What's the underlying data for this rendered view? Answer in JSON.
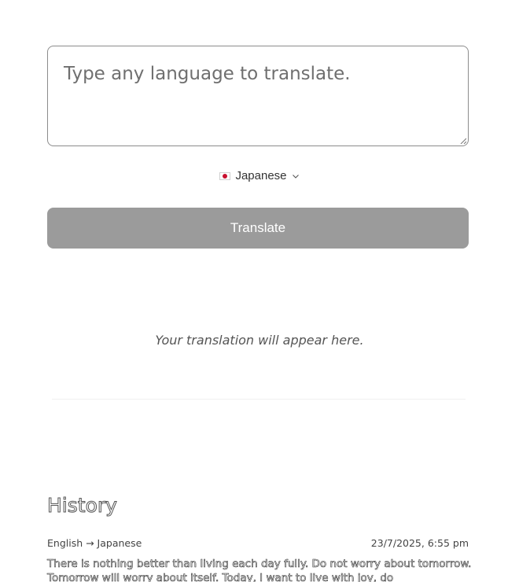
{
  "input": {
    "placeholder": "Type any language to translate.",
    "value": ""
  },
  "language_selector": {
    "flag": "japan-flag",
    "selected": "Japanese",
    "icon": "chevron-down-icon"
  },
  "translate_button": {
    "label": "Translate",
    "color": "#9b9b9b"
  },
  "result": {
    "placeholder": "Your translation will appear here."
  },
  "history": {
    "title": "History",
    "items": [
      {
        "direction": "English → Japanese",
        "timestamp": "23/7/2025, 6:55 pm",
        "text": "There is nothing better than living each day fully. Do not worry about tomorrow. Tomorrow will worry about itself. Today, I want to live with joy, do"
      }
    ]
  }
}
